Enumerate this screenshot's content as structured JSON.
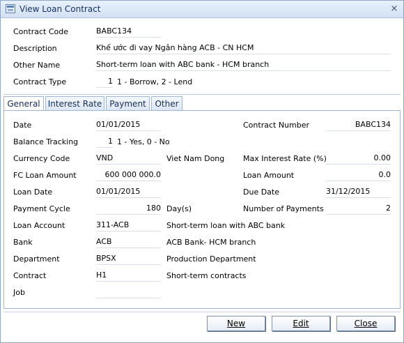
{
  "window": {
    "title": "View Loan Contract"
  },
  "header": {
    "contract_code": {
      "label": "Contract Code",
      "value": "BABC134"
    },
    "description": {
      "label": "Description",
      "value": "Khế ước đi vay Ngân hàng ACB - CN HCM"
    },
    "other_name": {
      "label": "Other Name",
      "value": "Short-term loan with ABC bank - HCM branch"
    },
    "contract_type": {
      "label": "Contract Type",
      "value": "1",
      "hint": "1 - Borrow, 2 - Lend"
    }
  },
  "tabs": [
    {
      "label": "General",
      "active": true
    },
    {
      "label": "Interest Rate",
      "active": false
    },
    {
      "label": "Payment",
      "active": false
    },
    {
      "label": "Other",
      "active": false
    }
  ],
  "general": {
    "date": {
      "label": "Date",
      "value": "01/01/2015"
    },
    "balance_tracking": {
      "label": "Balance Tracking",
      "value": "1",
      "hint": "1 - Yes, 0 - No"
    },
    "currency_code": {
      "label": "Currency Code",
      "value": "VND",
      "desc": "Viet Nam Dong"
    },
    "fc_loan_amount": {
      "label": "FC Loan Amount",
      "value": "600 000 000.0"
    },
    "loan_date": {
      "label": "Loan Date",
      "value": "01/01/2015"
    },
    "payment_cycle": {
      "label": "Payment Cycle",
      "value": "180",
      "unit": "Day(s)"
    },
    "loan_account": {
      "label": "Loan Account",
      "value": "311-ACB",
      "desc": "Short-term loan with ABC bank"
    },
    "bank": {
      "label": "Bank",
      "value": "ACB",
      "desc": "ACB Bank- HCM branch"
    },
    "department": {
      "label": "Department",
      "value": "BPSX",
      "desc": "Production Department"
    },
    "contract": {
      "label": "Contract",
      "value": "H1",
      "desc": "Short-term contracts"
    },
    "job": {
      "label": "Job",
      "value": ""
    },
    "contract_number": {
      "label": "Contract Number",
      "value": "BABC134"
    },
    "max_interest_rate": {
      "label": "Max Interest Rate (%)",
      "value": "0.00"
    },
    "loan_amount": {
      "label": "Loan Amount",
      "value": "0.0"
    },
    "due_date": {
      "label": "Due Date",
      "value": "31/12/2015"
    },
    "number_of_payments": {
      "label": "Number of Payments",
      "value": "2"
    }
  },
  "buttons": {
    "new": "New",
    "edit": "Edit",
    "close": "Close"
  },
  "icons": {
    "window": "contract-window-icon",
    "close": "close-icon"
  }
}
